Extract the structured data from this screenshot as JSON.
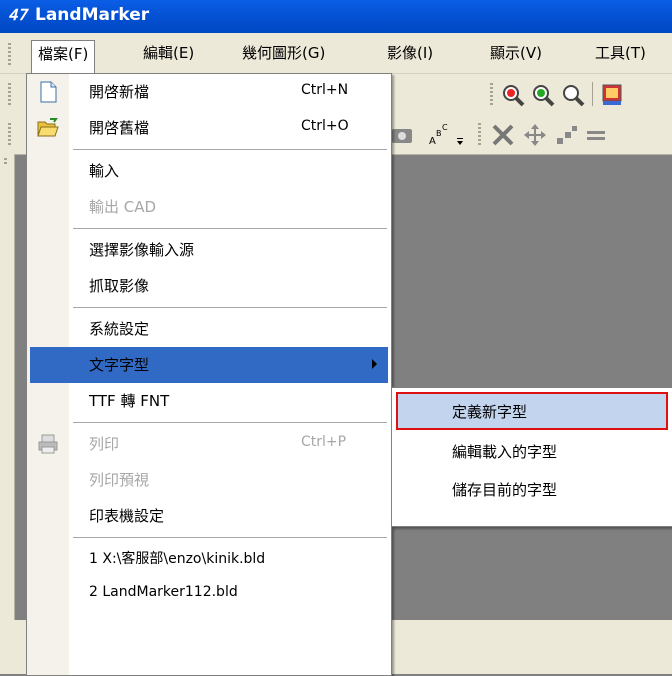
{
  "window": {
    "logo": "𝟦𝟩",
    "title": "LandMarker"
  },
  "menubar": [
    {
      "label": "檔案(F)",
      "open": true
    },
    {
      "label": "編輯(E)"
    },
    {
      "label": "幾何圖形(G)"
    },
    {
      "label": "影像(I)"
    },
    {
      "label": "顯示(V)"
    },
    {
      "label": "工具(T)"
    }
  ],
  "file_menu": {
    "new_file": "開啓新檔",
    "new_file_shortcut": "Ctrl+N",
    "open_file": "開啓舊檔",
    "open_file_shortcut": "Ctrl+O",
    "import": "輸入",
    "export_cad": "輸出 CAD",
    "select_source": "選擇影像輸入源",
    "capture": "抓取影像",
    "system_settings": "系統設定",
    "font": "文字字型",
    "ttf_to_fnt": "TTF 轉 FNT",
    "print": "列印",
    "print_shortcut": "Ctrl+P",
    "print_preview": "列印預視",
    "printer_setup": "印表機設定",
    "recent_1": "1 X:\\客服部\\enzo\\kinik.bld",
    "recent_2": "2 LandMarker112.bld"
  },
  "font_submenu": {
    "define_new": "定義新字型",
    "edit_loaded": "編輯載入的字型",
    "save_current": "儲存目前的字型"
  },
  "colors": {
    "title_bar": "#0553d6",
    "menu_highlight": "#316ac5",
    "submenu_highlight": "#c2d4ee",
    "focus_border": "#dd1111"
  }
}
